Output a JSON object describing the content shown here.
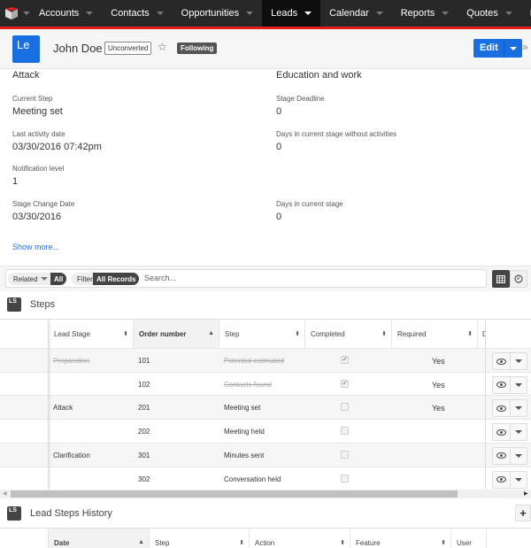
{
  "nav": {
    "logo": "app-logo",
    "items": [
      {
        "label": "Accounts",
        "active": false
      },
      {
        "label": "Contacts",
        "active": false
      },
      {
        "label": "Opportunities",
        "active": false
      },
      {
        "label": "Leads",
        "active": true
      },
      {
        "label": "Calendar",
        "active": false
      },
      {
        "label": "Reports",
        "active": false
      },
      {
        "label": "Quotes",
        "active": false
      },
      {
        "label": "Documents",
        "active": false
      }
    ],
    "more_icon": "chevron-down-icon"
  },
  "header": {
    "avatar_text": "Le",
    "name": "John Doe",
    "status_badge": "Unconverted",
    "favorite_icon": "star-icon",
    "following_badge": "Following",
    "edit_label": "Edit",
    "collapse_icon": "double-chevron-right-icon"
  },
  "colors": {
    "accent": "#1a6fe0",
    "nav_bg": "#282828",
    "header_line": "#e01e1e"
  },
  "fields": {
    "left": [
      {
        "label": "",
        "value": "Attack"
      },
      {
        "label": "Current Step",
        "value": "Meeting set"
      },
      {
        "label": "Last activity date",
        "value": "03/30/2016 07:42pm"
      },
      {
        "label": "Notification level",
        "value": "1"
      },
      {
        "label": "Stage Change Date",
        "value": "03/30/2016"
      }
    ],
    "right": [
      {
        "label": "",
        "value": "Education and work"
      },
      {
        "label": "Stage Deadline",
        "value": "0"
      },
      {
        "label": "Days in current stage without activities",
        "value": "0"
      },
      {
        "label": "Days in current stage",
        "value": "0"
      }
    ],
    "show_more": "Show more..."
  },
  "filter": {
    "related_label": "Related",
    "related_value": "All",
    "filter_label": "Filter",
    "filter_value": "All Records",
    "search_placeholder": "Search..."
  },
  "steps": {
    "badge": "LS",
    "title": "Steps",
    "columns": [
      "Lead Stage",
      "Order number",
      "Step",
      "Completed",
      "Required",
      "D"
    ],
    "rows": [
      {
        "stage": "Preparation",
        "order": "101",
        "step": "Potential estimated",
        "completed": true,
        "required": "Yes",
        "done": true
      },
      {
        "stage": "",
        "order": "102",
        "step": "Contacts found",
        "completed": true,
        "required": "Yes",
        "done": true
      },
      {
        "stage": "Attack",
        "order": "201",
        "step": "Meeting set",
        "completed": false,
        "required": "Yes",
        "done": false
      },
      {
        "stage": "",
        "order": "202",
        "step": "Meeting held",
        "completed": false,
        "required": "",
        "done": false
      },
      {
        "stage": "Clarification",
        "order": "301",
        "step": "Minutes sent",
        "completed": false,
        "required": "",
        "done": false
      },
      {
        "stage": "",
        "order": "302",
        "step": "Conversation held",
        "completed": false,
        "required": "",
        "done": false
      }
    ]
  },
  "history": {
    "badge": "LS",
    "title": "Lead Steps History",
    "add_label": "+",
    "columns": [
      "Date",
      "Step",
      "Action",
      "Feature",
      "User"
    ]
  }
}
